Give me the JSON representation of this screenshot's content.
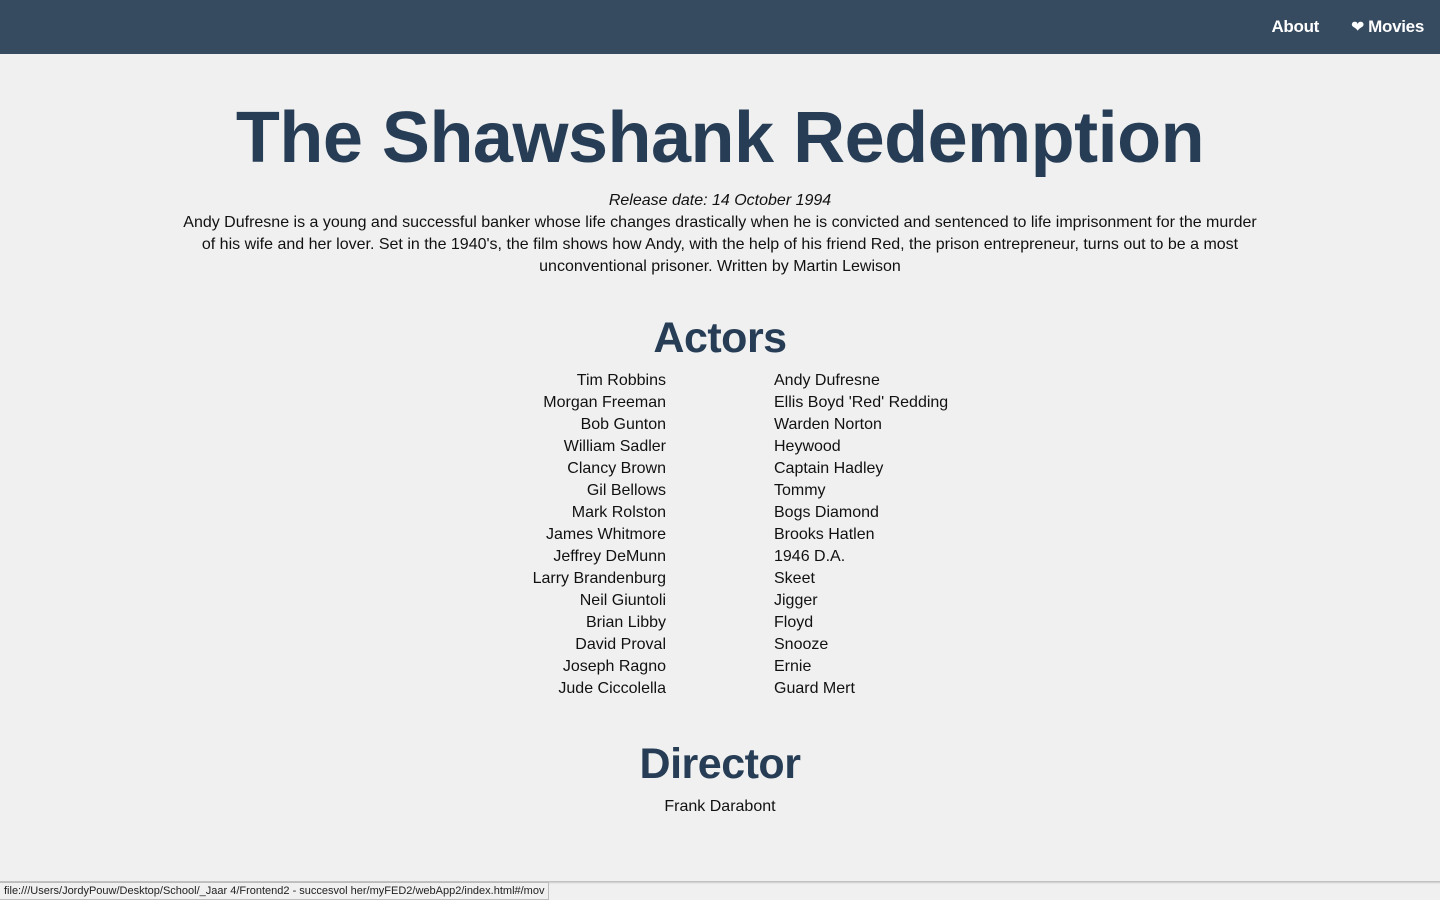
{
  "nav": {
    "about_label": "About",
    "movies_icon": "heart-icon",
    "movies_icon_glyph": "❤",
    "movies_label": "Movies"
  },
  "movie": {
    "title": "The Shawshank Redemption",
    "release_date": "Release date: 14 October 1994",
    "description": "Andy Dufresne is a young and successful banker whose life changes drastically when he is convicted and sentenced to life imprisonment for the murder of his wife and her lover. Set in the 1940's, the film shows how Andy, with the help of his friend Red, the prison entrepreneur, turns out to be a most unconventional prisoner. Written by Martin Lewison"
  },
  "actors": {
    "heading": "Actors",
    "list": [
      {
        "name": "Tim Robbins",
        "role": "Andy Dufresne"
      },
      {
        "name": "Morgan Freeman",
        "role": "Ellis Boyd 'Red' Redding"
      },
      {
        "name": "Bob Gunton",
        "role": "Warden Norton"
      },
      {
        "name": "William Sadler",
        "role": "Heywood"
      },
      {
        "name": "Clancy Brown",
        "role": "Captain Hadley"
      },
      {
        "name": "Gil Bellows",
        "role": "Tommy"
      },
      {
        "name": "Mark Rolston",
        "role": "Bogs Diamond"
      },
      {
        "name": "James Whitmore",
        "role": "Brooks Hatlen"
      },
      {
        "name": "Jeffrey DeMunn",
        "role": "1946 D.A."
      },
      {
        "name": "Larry Brandenburg",
        "role": "Skeet"
      },
      {
        "name": "Neil Giuntoli",
        "role": "Jigger"
      },
      {
        "name": "Brian Libby",
        "role": "Floyd"
      },
      {
        "name": "David Proval",
        "role": "Snooze"
      },
      {
        "name": "Joseph Ragno",
        "role": "Ernie"
      },
      {
        "name": "Jude Ciccolella",
        "role": "Guard Mert"
      }
    ]
  },
  "director": {
    "heading": "Director",
    "name": "Frank Darabont"
  },
  "status_bar": {
    "url": "file:///Users/JordyPouw/Desktop/School/_Jaar 4/Frontend2 - succesvol her/myFED2/webApp2/index.html#/mov"
  },
  "colors": {
    "navbar": "#364a60",
    "heading": "#263d55",
    "background": "#f0f0f0"
  }
}
